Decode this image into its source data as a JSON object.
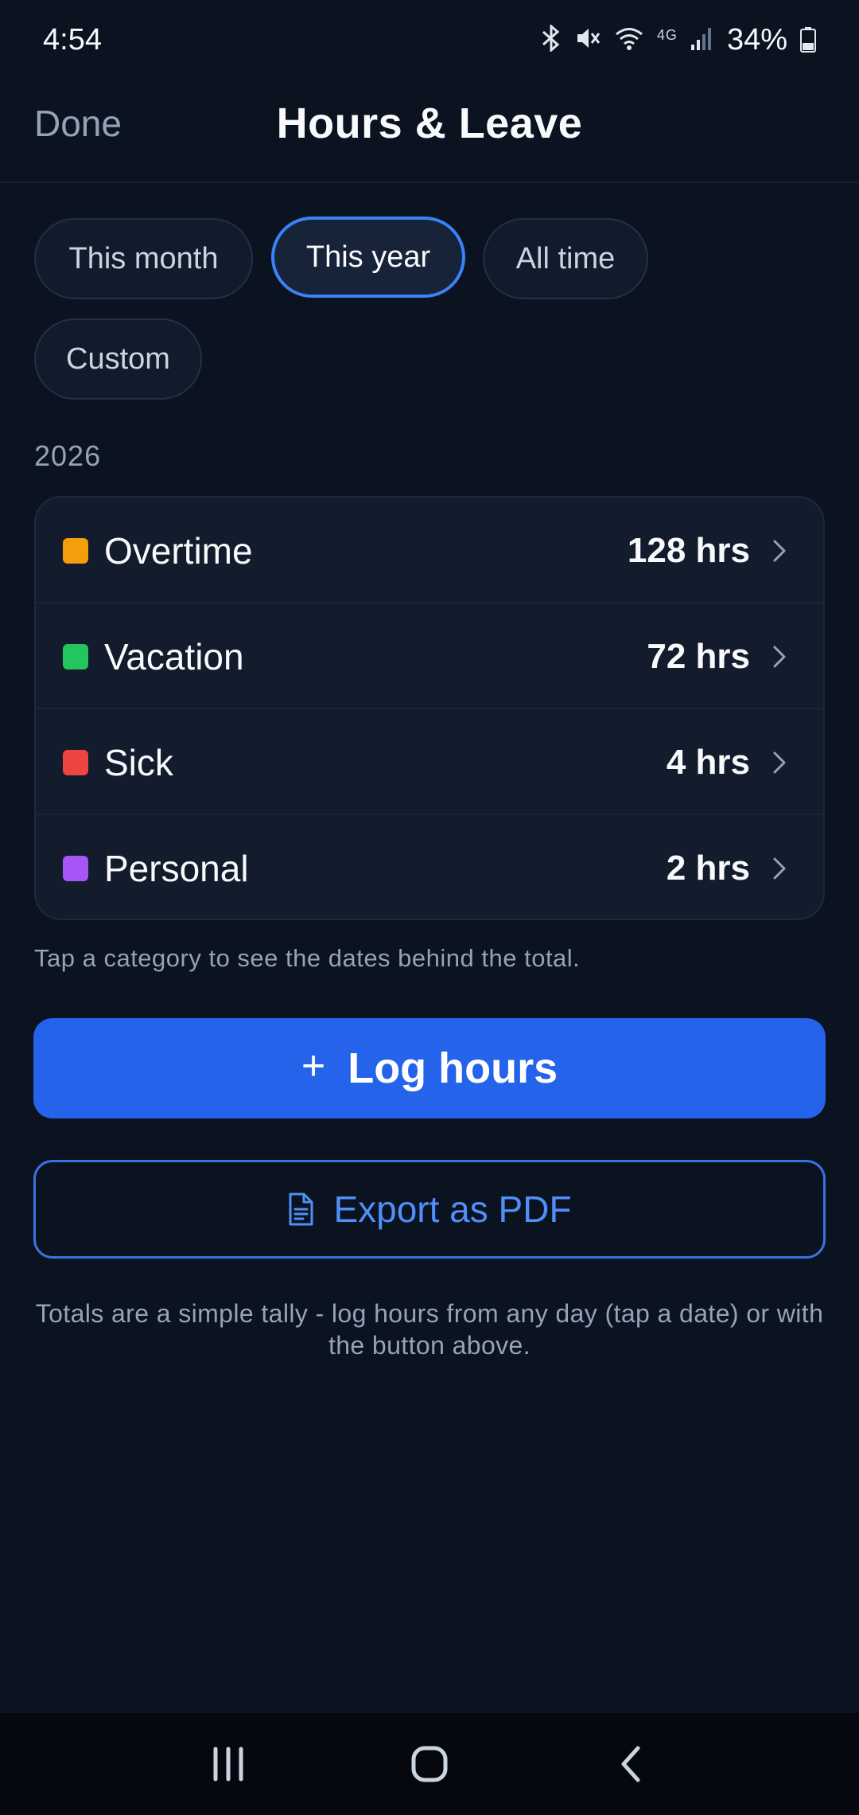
{
  "status_bar": {
    "time": "4:54",
    "network_label": "4G",
    "battery_percent": "34%",
    "icons": [
      "bluetooth-icon",
      "mute-icon",
      "wifi-icon",
      "lte-icon",
      "signal-icon",
      "battery-icon"
    ]
  },
  "header": {
    "done_label": "Done",
    "title": "Hours & Leave"
  },
  "filters": {
    "options": [
      "This month",
      "This year",
      "All time",
      "Custom"
    ],
    "selected": "This year"
  },
  "period_label": "2026",
  "categories": [
    {
      "label": "Overtime",
      "value": "128 hrs",
      "color": "#f59e0b"
    },
    {
      "label": "Vacation",
      "value": "72 hrs",
      "color": "#22c55e"
    },
    {
      "label": "Sick",
      "value": "4 hrs",
      "color": "#ef4444"
    },
    {
      "label": "Personal",
      "value": "2 hrs",
      "color": "#a855f7"
    }
  ],
  "hint": "Tap a category to see the dates behind the total.",
  "actions": {
    "log_hours_label": "Log hours",
    "export_label": "Export as PDF"
  },
  "footnote": "Totals are a simple tally - log hours from any day (tap a date) or with the button above.",
  "colors": {
    "background": "#0b1220",
    "accent": "#2563eb",
    "outline_accent": "#4f8ff7"
  }
}
